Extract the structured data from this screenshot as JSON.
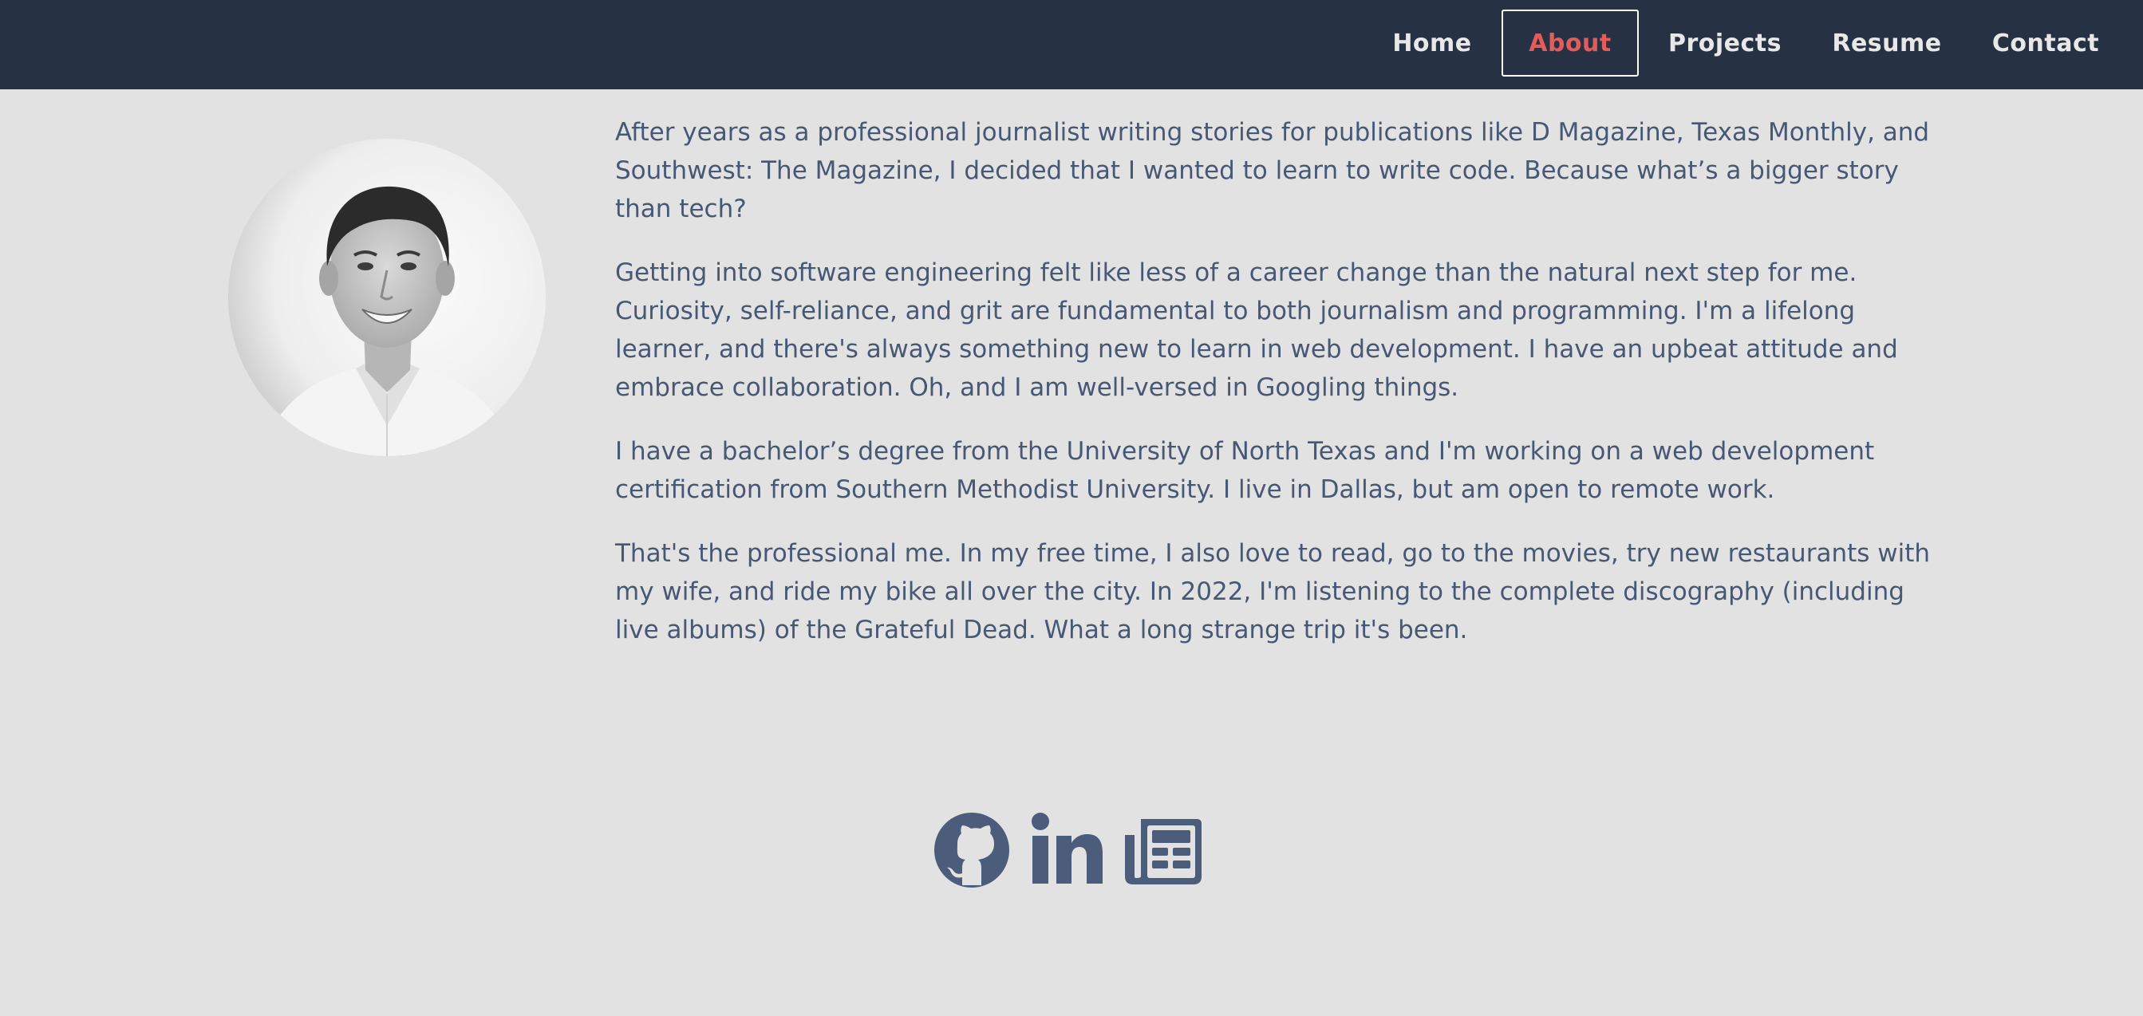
{
  "nav": {
    "items": [
      {
        "label": "Home",
        "active": false
      },
      {
        "label": "About",
        "active": true
      },
      {
        "label": "Projects",
        "active": false
      },
      {
        "label": "Resume",
        "active": false
      },
      {
        "label": "Contact",
        "active": false
      }
    ]
  },
  "about": {
    "paragraphs": [
      "After years as a professional journalist writing stories for publications like D Magazine, Texas Monthly, and Southwest: The Magazine, I decided that I wanted to learn to write code. Because what’s a bigger story than tech?",
      "Getting into software engineering felt like less of a career change than the natural next step for me. Curiosity, self-reliance, and grit are fundamental to both journalism and programming. I'm a lifelong learner, and there's always something new to learn in web development. I have an upbeat attitude and embrace collaboration. Oh, and I am well-versed in Googling things.",
      "I have a bachelor’s degree from the University of North Texas and I'm working on a web development certification from Southern Methodist University. I live in Dallas, but am open to remote work.",
      "That's the professional me. In my free time, I also love to read, go to the movies, try new restaurants with my wife, and ride my bike all over the city. In 2022, I'm listening to the complete discography (including live albums) of the Grateful Dead. What a long strange trip it's been."
    ]
  },
  "social": {
    "icons": [
      "github-icon",
      "linkedin-icon",
      "newspaper-icon"
    ]
  },
  "colors": {
    "navbar_bg": "#263243",
    "page_bg": "#e2e2e2",
    "text": "#475875",
    "active_link": "#e25d5a",
    "icon": "#4b5d7a"
  }
}
